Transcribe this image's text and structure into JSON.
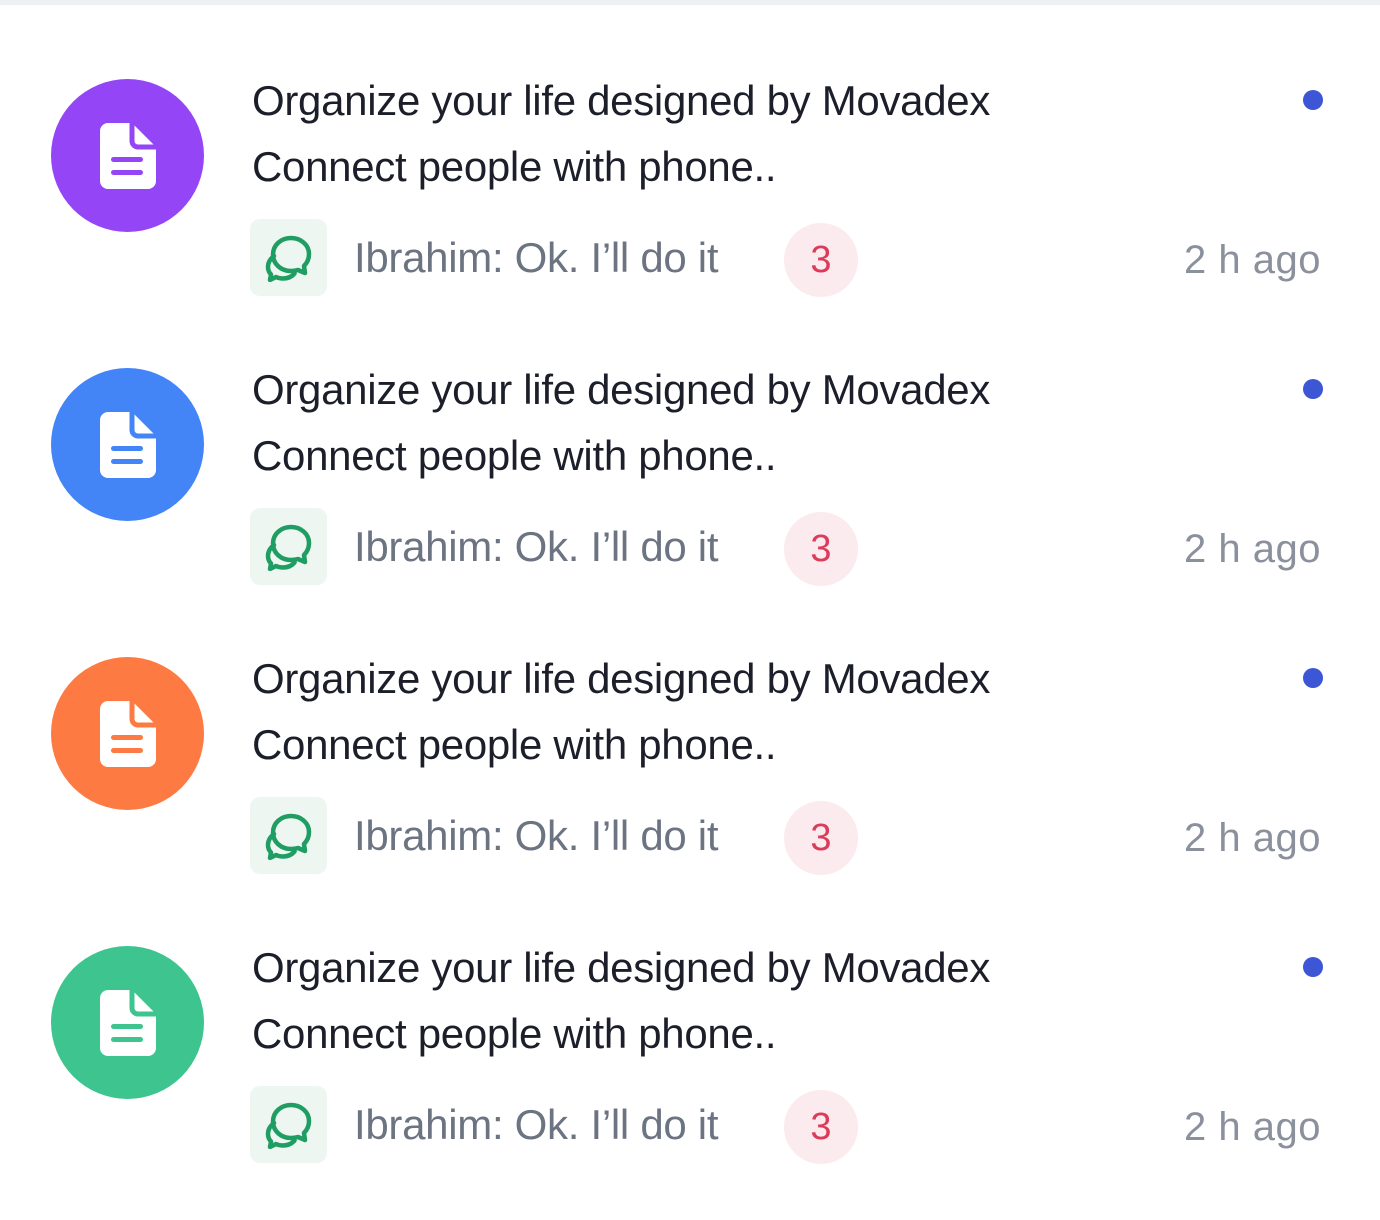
{
  "notifications": [
    {
      "title": "Organize your life designed by Movadex",
      "subtitle": "Connect people with phone..",
      "message": "Ibrahim: Ok. I’ll do it",
      "count": "3",
      "time": "2 h ago",
      "avatar_color": "#9446f7",
      "avatar_icon": "document-icon",
      "chat_icon": "chat-bubbles-icon",
      "unread": true
    },
    {
      "title": "Organize your life designed by Movadex",
      "subtitle": "Connect people with phone..",
      "message": "Ibrahim: Ok. I’ll do it",
      "count": "3",
      "time": "2 h ago",
      "avatar_color": "#4384f7",
      "avatar_icon": "document-icon",
      "chat_icon": "chat-bubbles-icon",
      "unread": true
    },
    {
      "title": "Organize your life designed by Movadex",
      "subtitle": "Connect people with phone..",
      "message": "Ibrahim: Ok. I’ll do it",
      "count": "3",
      "time": "2 h ago",
      "avatar_color": "#fd7a42",
      "avatar_icon": "document-icon",
      "chat_icon": "chat-bubbles-icon",
      "unread": true
    },
    {
      "title": "Organize your life designed by Movadex",
      "subtitle": "Connect people with phone..",
      "message": "Ibrahim: Ok. I’ll do it",
      "count": "3",
      "time": "2 h ago",
      "avatar_color": "#3ec58f",
      "avatar_icon": "document-icon",
      "chat_icon": "chat-bubbles-icon",
      "unread": true
    }
  ],
  "colors": {
    "unread_dot": "#3c56d6",
    "chat_icon": "#1f9d63",
    "badge_text": "#dc3b5a",
    "badge_bg": "#fbeaee"
  }
}
